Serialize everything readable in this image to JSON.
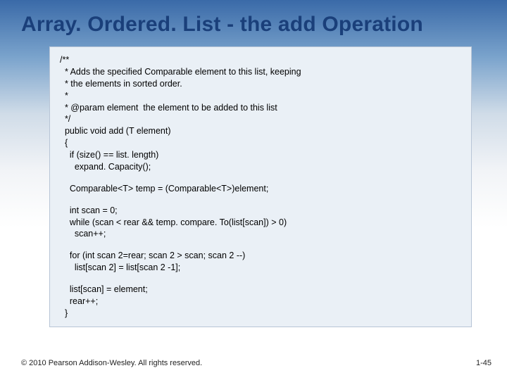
{
  "slide": {
    "title": "Array. Ordered. List - the add Operation",
    "footer": "© 2010 Pearson Addison-Wesley. All rights reserved.",
    "page_number": "1-45"
  },
  "code": {
    "lines": [
      "/**",
      "  * Adds the specified Comparable element to this list, keeping",
      "  * the elements in sorted order.",
      "  *",
      "  * @param element  the element to be added to this list",
      "  */",
      "  public void add (T element)",
      "  {",
      "    if (size() == list. length)",
      "      expand. Capacity();",
      "",
      "    Comparable<T> temp = (Comparable<T>)element;",
      "",
      "    int scan = 0;",
      "    while (scan < rear && temp. compare. To(list[scan]) > 0)",
      "      scan++;",
      "",
      "    for (int scan 2=rear; scan 2 > scan; scan 2 --)",
      "      list[scan 2] = list[scan 2 -1];",
      "",
      "    list[scan] = element;",
      "    rear++;",
      "  }"
    ]
  }
}
